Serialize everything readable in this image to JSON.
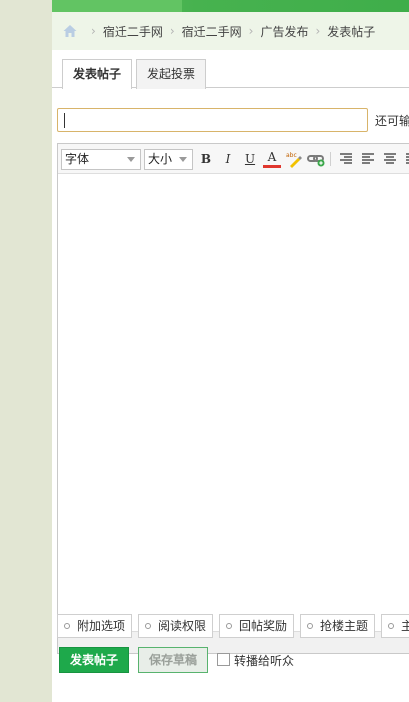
{
  "breadcrumb": {
    "items": [
      "宿迁二手网",
      "宿迁二手网",
      "广告发布",
      "发表帖子"
    ]
  },
  "tabs": [
    "发表帖子",
    "发起投票"
  ],
  "title_field": {
    "value": "",
    "remaining_label": "还可输"
  },
  "toolbar": {
    "font_label": "字体",
    "size_label": "大小",
    "bold": "B",
    "italic": "I",
    "underline": "U",
    "font_color": "A"
  },
  "options": [
    "附加选项",
    "阅读权限",
    "回帖奖励",
    "抢楼主题",
    "主"
  ],
  "actions": {
    "post": "发表帖子",
    "save_draft": "保存草稿",
    "broadcast_label": "转播给听众"
  },
  "colors": {
    "brand_green": "#1ea94b",
    "title_border": "#d8b46a",
    "font_color_underline": "#e0372e"
  }
}
